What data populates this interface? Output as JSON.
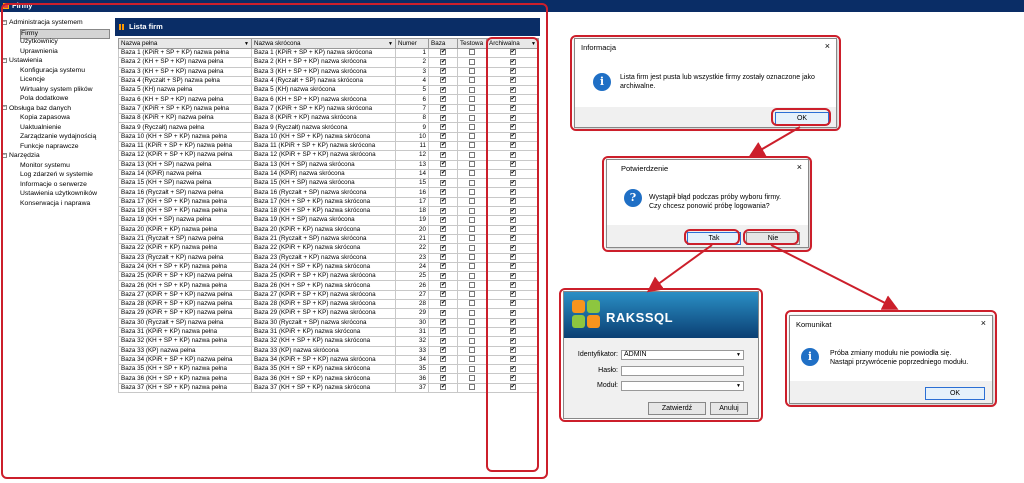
{
  "window": {
    "title": "Firmy"
  },
  "tree": {
    "groups": [
      {
        "label": "Administracja systemem",
        "items": [
          "Firmy",
          "Użytkownicy",
          "Uprawnienia"
        ]
      },
      {
        "label": "Ustawienia",
        "items": [
          "Konfiguracja systemu",
          "Licencje",
          "Wirtualny system plików",
          "Pola dodatkowe"
        ]
      },
      {
        "label": "Obsługa baz danych",
        "items": [
          "Kopia zapasowa",
          "Uaktualnienie",
          "Zarządzanie wydajnością",
          "Funkcje naprawcze"
        ]
      },
      {
        "label": "Narzędzia",
        "items": [
          "Monitor systemu",
          "Log zdarzeń w systemie",
          "Informacje o serwerze",
          "Ustawienia użytkowników",
          "Konserwacja i naprawa"
        ]
      }
    ],
    "selected": "Firmy"
  },
  "companies": {
    "title": "Lista firm",
    "columns": [
      "Nazwa pełna",
      "Nazwa skrócona",
      "Numer",
      "Baza",
      "Testowa",
      "Archiwalna"
    ],
    "rows": [
      [
        "Baza 1 (KPiR + SP + KP) nazwa pełna",
        "Baza 1 (KPiR + SP + KP) nazwa skrócona",
        "1"
      ],
      [
        "Baza 2 (KH + SP + KP) nazwa pełna",
        "Baza 2 (KH + SP + KP) nazwa skrócona",
        "2"
      ],
      [
        "Baza 3 (KH + SP + KP) nazwa pełna",
        "Baza 3 (KH + SP + KP) nazwa skrócona",
        "3"
      ],
      [
        "Baza 4 (Ryczałt + SP) nazwa pełna",
        "Baza 4 (Ryczałt + SP) nazwa skrócona",
        "4"
      ],
      [
        "Baza 5 (KH) nazwa pełna",
        "Baza 5 (KH) nazwa skrócona",
        "5"
      ],
      [
        "Baza 6 (KH + SP + KP) nazwa pełna",
        "Baza 6 (KH + SP + KP) nazwa skrócona",
        "6"
      ],
      [
        "Baza 7 (KPiR + SP + KP) nazwa pełna",
        "Baza 7 (KPiR + SP + KP) nazwa skrócona",
        "7"
      ],
      [
        "Baza 8 (KPiR + KP) nazwa pełna",
        "Baza 8 (KPiR + KP) nazwa skrócona",
        "8"
      ],
      [
        "Baza 9 (Ryczałt) nazwa pełna",
        "Baza 9 (Ryczałt) nazwa skrócona",
        "9"
      ],
      [
        "Baza 10 (KH + SP + KP) nazwa pełna",
        "Baza 10 (KH + SP + KP) nazwa skrócona",
        "10"
      ],
      [
        "Baza 11 (KPiR + SP + KP) nazwa pełna",
        "Baza 11 (KPiR + SP + KP) nazwa skrócona",
        "11"
      ],
      [
        "Baza 12 (KPiR + SP + KP) nazwa pełna",
        "Baza 12 (KPiR + SP + KP) nazwa skrócona",
        "12"
      ],
      [
        "Baza 13 (KH + SP) nazwa pełna",
        "Baza 13 (KH + SP) nazwa skrócona",
        "13"
      ],
      [
        "Baza 14 (KPiR) nazwa pełna",
        "Baza 14 (KPiR) nazwa skrócona",
        "14"
      ],
      [
        "Baza 15 (KH + SP) nazwa pełna",
        "Baza 15 (KH + SP) nazwa skrócona",
        "15"
      ],
      [
        "Baza 16 (Ryczałt + SP) nazwa pełna",
        "Baza 16 (Ryczałt + SP) nazwa skrócona",
        "16"
      ],
      [
        "Baza 17 (KH + SP + KP) nazwa pełna",
        "Baza 17 (KH + SP + KP) nazwa skrócona",
        "17"
      ],
      [
        "Baza 18 (KH + SP + KP) nazwa pełna",
        "Baza 18 (KH + SP + KP) nazwa skrócona",
        "18"
      ],
      [
        "Baza 19 (KH + SP) nazwa pełna",
        "Baza 19 (KH + SP) nazwa skrócona",
        "19"
      ],
      [
        "Baza 20 (KPiR + KP) nazwa pełna",
        "Baza 20 (KPiR + KP) nazwa skrócona",
        "20"
      ],
      [
        "Baza 21 (Ryczałt + SP) nazwa pełna",
        "Baza 21 (Ryczałt + SP) nazwa skrócona",
        "21"
      ],
      [
        "Baza 22 (KPiR + KP) nazwa pełna",
        "Baza 22 (KPiR + KP) nazwa skrócona",
        "22"
      ],
      [
        "Baza 23 (Ryczałt + KP) nazwa pełna",
        "Baza 23 (Ryczałt + KP) nazwa skrócona",
        "23"
      ],
      [
        "Baza 24 (KH + SP + KP) nazwa pełna",
        "Baza 24 (KH + SP + KP) nazwa skrócona",
        "24"
      ],
      [
        "Baza 25 (KPiR + SP + KP) nazwa pełna",
        "Baza 25 (KPiR + SP + KP) nazwa skrócona",
        "25"
      ],
      [
        "Baza 26 (KH + SP + KP) nazwa pełna",
        "Baza 26 (KH + SP + KP) nazwa skrócona",
        "26"
      ],
      [
        "Baza 27 (KPiR + SP + KP) nazwa pełna",
        "Baza 27 (KPiR + SP + KP) nazwa skrócona",
        "27"
      ],
      [
        "Baza 28 (KPiR + SP + KP) nazwa pełna",
        "Baza 28 (KPiR + SP + KP) nazwa skrócona",
        "28"
      ],
      [
        "Baza 29 (KPiR + SP + KP) nazwa pełna",
        "Baza 29 (KPiR + SP + KP) nazwa skrócona",
        "29"
      ],
      [
        "Baza 30 (Ryczałt + SP) nazwa pełna",
        "Baza 30 (Ryczałt + SP) nazwa skrócona",
        "30"
      ],
      [
        "Baza 31 (KPiR + KP) nazwa pełna",
        "Baza 31 (KPiR + KP) nazwa skrócona",
        "31"
      ],
      [
        "Baza 32 (KH + SP + KP) nazwa pełna",
        "Baza 32 (KH + SP + KP) nazwa skrócona",
        "32"
      ],
      [
        "Baza 33 (KP) nazwa pełna",
        "Baza 33 (KP) nazwa skrócona",
        "33"
      ],
      [
        "Baza 34 (KPiR + SP + KP) nazwa pełna",
        "Baza 34 (KPiR + SP + KP) nazwa skrócona",
        "34"
      ],
      [
        "Baza 35 (KH + SP + KP) nazwa pełna",
        "Baza 35 (KH + SP + KP) nazwa skrócona",
        "35"
      ],
      [
        "Baza 36 (KH + SP + KP) nazwa pełna",
        "Baza 36 (KH + SP + KP) nazwa skrócona",
        "36"
      ],
      [
        "Baza 37 (KH + SP + KP) nazwa pełna",
        "Baza 37 (KH + SP + KP) nazwa skrócona",
        "37"
      ]
    ]
  },
  "dialog_info": {
    "title": "Informacja",
    "message_line1": "Lista firm jest pusta lub wszystkie firmy zostały oznaczone jako",
    "message_line2": "archiwalne.",
    "ok_label": "OK"
  },
  "dialog_confirm": {
    "title": "Potwierdzenie",
    "message_line1": "Wystąpił błąd podczas próby wyboru firmy.",
    "message_line2": "Czy chcesz ponowić próbę logowania?",
    "yes_label": "Tak",
    "no_label": "Nie"
  },
  "dialog_message": {
    "title": "Komunikat",
    "message_line1": "Próba zmiany modułu nie powiodła się.",
    "message_line2": "Nastąpi przywrócenie poprzedniego modułu.",
    "ok_label": "OK"
  },
  "login": {
    "brand": "RAKSSQL",
    "id_label": "Identyfikator:",
    "id_value": "ADMIN",
    "password_label": "Hasło:",
    "module_label": "Moduł:",
    "confirm_label": "Zatwierdź",
    "cancel_label": "Anuluj"
  },
  "colors": {
    "annotation": "#cc1f2b",
    "titlebar": "#0a2d66",
    "info_icon": "#1f6fc5"
  }
}
